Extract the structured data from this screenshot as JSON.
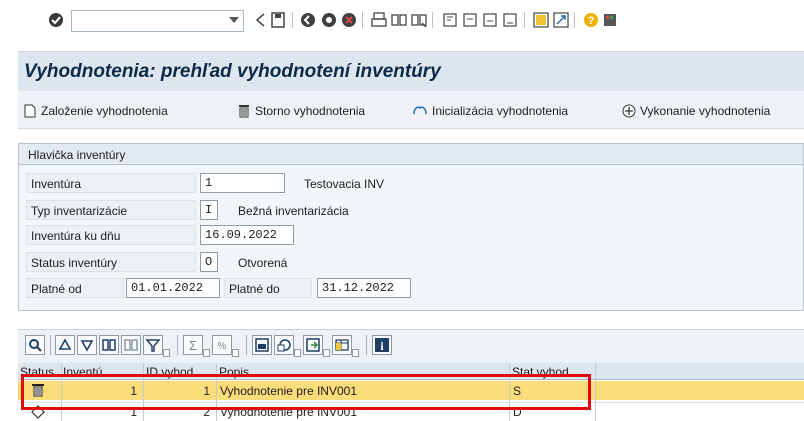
{
  "toolbar": {
    "command_field": "",
    "icons": [
      "ok-icon",
      "back-icon",
      "save-icon",
      "nav-back-icon",
      "exit-icon",
      "cancel-icon",
      "print-icon",
      "find-icon",
      "find-next-icon",
      "first-page-icon",
      "prev-page-icon",
      "next-page-icon",
      "last-page-icon",
      "new-session-icon",
      "shortcut-icon",
      "help-icon",
      "customize-icon"
    ]
  },
  "page": {
    "title": "Vyhodnotenia: prehľad vyhodnotení inventúry"
  },
  "app_toolbar": {
    "create": "Založenie vyhodnotenia",
    "cancel": "Storno vyhodnotenia",
    "init": "Inicializácia vyhodnotenia",
    "execute": "Vykonanie vyhodnotenia"
  },
  "header": {
    "title": "Hlavička inventúry",
    "inventory_label": "Inventúra",
    "inventory_value": "1",
    "inventory_desc": "Testovacia INV",
    "type_label": "Typ inventarizácie",
    "type_value": "I",
    "type_desc": "Bežná inventarizácia",
    "date_label": "Inventúra ku dňu",
    "date_value": "16.09.2022",
    "status_label": "Status inventúry",
    "status_value": "O",
    "status_desc": "Otvorená",
    "valid_from_label": "Platné od",
    "valid_from_value": "01.01.2022",
    "valid_to_label": "Platné do",
    "valid_to_value": "31.12.2022"
  },
  "grid": {
    "columns": [
      "Status",
      "Inventú",
      "ID vyhod.",
      "Popis",
      "Stat.vyhod."
    ],
    "rows": [
      {
        "status_icon": "trash-icon",
        "inventory": "1",
        "id": "1",
        "description": "Vyhodnotenie pre INV001",
        "stat": "S"
      },
      {
        "status_icon": "diamond-icon",
        "inventory": "1",
        "id": "2",
        "description": "Vyhodnotenie pre INV001",
        "stat": "D"
      }
    ]
  },
  "colors": {
    "accent": "#0e2a47",
    "selected_row": "#fbdc7a",
    "highlight_border": "#e00b0b"
  }
}
